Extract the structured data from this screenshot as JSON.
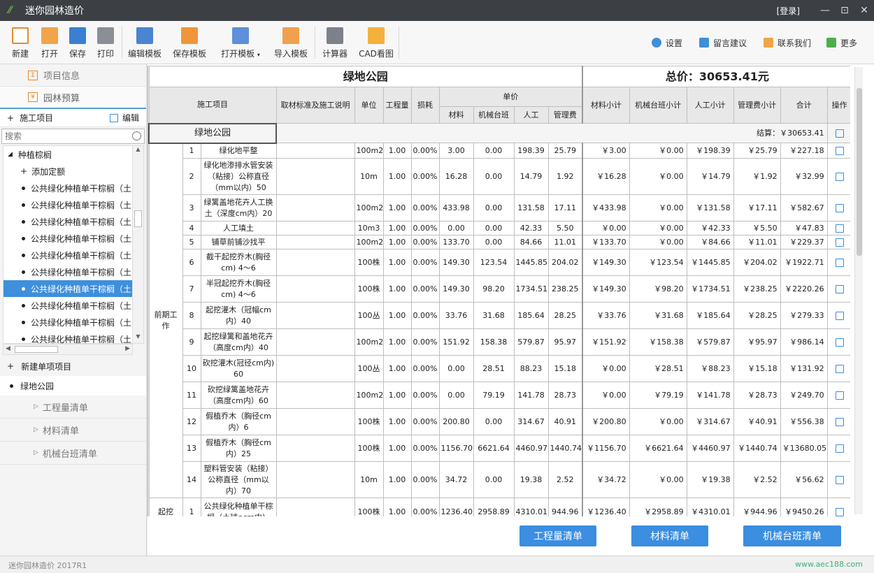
{
  "app": {
    "title": "迷你园林造价",
    "login": "[登录]",
    "version": "迷你园林造价 2017R1",
    "website": "www.aec188.com"
  },
  "window": {
    "minimize": "—",
    "restore": "⊡",
    "close": "✕"
  },
  "toolbar": {
    "new": "新建",
    "open": "打开",
    "save": "保存",
    "print": "打印",
    "edit_template": "编辑模板",
    "save_template": "保存模板",
    "open_template": "打开模板",
    "import_template": "导入模板",
    "calculator": "计算器",
    "cad": "CAD看图",
    "settings": "设置",
    "feedback": "留言建议",
    "contact": "联系我们",
    "more": "更多"
  },
  "sidebar": {
    "tab_project_info": "项目信息",
    "tab_budget": "园林预算",
    "construction_items": "施工项目",
    "edit": "编辑",
    "search_placeholder": "搜索",
    "tree": {
      "group": "种植棕榈",
      "add_quota": "添加定额",
      "items": [
        "公共绿化种植单干棕榈（土",
        "公共绿化种植单干棕榈（土",
        "公共绿化种植单干棕榈（土",
        "公共绿化种植单干棕榈（土",
        "公共绿化种植单干棕榈（土",
        "公共绿化种植单干棕榈（土",
        "公共绿化种植单干棕榈（土",
        "公共绿化种植单干棕榈（土",
        "公共绿化种植单干棕榈（土",
        "公共绿化种植单干棕榈（土"
      ],
      "selected_index": 6
    },
    "new_item": "新建单项项目",
    "project": "绿地公园",
    "sections": [
      "工程量清单",
      "材料清单",
      "机械台班清单"
    ]
  },
  "sheet": {
    "title": "绿地公园",
    "total": "总价：30653.41元",
    "headers": {
      "item": "施工项目",
      "std": "取材标准及施工说明",
      "unit": "单位",
      "qty": "工程量",
      "loss": "损耗",
      "unit_price": "单价",
      "mat": "材料",
      "mach": "机械台班",
      "labor": "人工",
      "mgmt": "管理费",
      "mat_sub": "材料小计",
      "mach_sub": "机械台班小计",
      "labor_sub": "人工小计",
      "mgmt_sub": "管理费小计",
      "sum": "合计",
      "op": "操作"
    },
    "group_name": "绿地公园",
    "settlement": "结算：￥30653.41",
    "category_1": "前期工作",
    "category_2": "起挖",
    "rows": [
      [
        "1",
        "绿化地平整",
        "100m2",
        "1.00",
        "0.00%",
        "3.00",
        "0.00",
        "198.39",
        "25.79",
        "￥3.00",
        "￥0.00",
        "￥198.39",
        "￥25.79",
        "￥227.18"
      ],
      [
        "2",
        "绿化地渗排水管安装（粘接）公称直径（mm以内）50",
        "10m",
        "1.00",
        "0.00%",
        "16.28",
        "0.00",
        "14.79",
        "1.92",
        "￥16.28",
        "￥0.00",
        "￥14.79",
        "￥1.92",
        "￥32.99"
      ],
      [
        "3",
        "绿篱盖地花卉人工换土（深度cm内）20",
        "100m2",
        "1.00",
        "0.00%",
        "433.98",
        "0.00",
        "131.58",
        "17.11",
        "￥433.98",
        "￥0.00",
        "￥131.58",
        "￥17.11",
        "￥582.67"
      ],
      [
        "4",
        "人工填土",
        "10m3",
        "1.00",
        "0.00%",
        "0.00",
        "0.00",
        "42.33",
        "5.50",
        "￥0.00",
        "￥0.00",
        "￥42.33",
        "￥5.50",
        "￥47.83"
      ],
      [
        "5",
        "铺草前铺沙找平",
        "100m2",
        "1.00",
        "0.00%",
        "133.70",
        "0.00",
        "84.66",
        "11.01",
        "￥133.70",
        "￥0.00",
        "￥84.66",
        "￥11.01",
        "￥229.37"
      ],
      [
        "6",
        "截干起挖乔木(胸径cm) 4～6",
        "100株",
        "1.00",
        "0.00%",
        "149.30",
        "123.54",
        "1445.85",
        "204.02",
        "￥149.30",
        "￥123.54",
        "￥1445.85",
        "￥204.02",
        "￥1922.71"
      ],
      [
        "7",
        "半冠起挖乔木(胸径cm) 4～6",
        "100株",
        "1.00",
        "0.00%",
        "149.30",
        "98.20",
        "1734.51",
        "238.25",
        "￥149.30",
        "￥98.20",
        "￥1734.51",
        "￥238.25",
        "￥2220.26"
      ],
      [
        "8",
        "起挖灌木（冠幅cm内）40",
        "100丛",
        "1.00",
        "0.00%",
        "33.76",
        "31.68",
        "185.64",
        "28.25",
        "￥33.76",
        "￥31.68",
        "￥185.64",
        "￥28.25",
        "￥279.33"
      ],
      [
        "9",
        "起挖绿篱和盖地花卉（高度cm内）40",
        "100m2",
        "1.00",
        "0.00%",
        "151.92",
        "158.38",
        "579.87",
        "95.97",
        "￥151.92",
        "￥158.38",
        "￥579.87",
        "￥95.97",
        "￥986.14"
      ],
      [
        "10",
        "砍挖灌木(冠径cm内) 60",
        "100丛",
        "1.00",
        "0.00%",
        "0.00",
        "28.51",
        "88.23",
        "15.18",
        "￥0.00",
        "￥28.51",
        "￥88.23",
        "￥15.18",
        "￥131.92"
      ],
      [
        "11",
        "砍挖绿篱盖地花卉（高度cm内）60",
        "100m2",
        "1.00",
        "0.00%",
        "0.00",
        "79.19",
        "141.78",
        "28.73",
        "￥0.00",
        "￥79.19",
        "￥141.78",
        "￥28.73",
        "￥249.70"
      ],
      [
        "12",
        "假植乔木（胸径cm内）6",
        "100株",
        "1.00",
        "0.00%",
        "200.80",
        "0.00",
        "314.67",
        "40.91",
        "￥200.80",
        "￥0.00",
        "￥314.67",
        "￥40.91",
        "￥556.38"
      ],
      [
        "13",
        "假植乔木（胸径cm内）25",
        "100株",
        "1.00",
        "0.00%",
        "1156.70",
        "6621.64",
        "4460.97",
        "1440.74",
        "￥1156.70",
        "￥6621.64",
        "￥4460.97",
        "￥1440.74",
        "￥13680.05"
      ],
      [
        "14",
        "塑料管安装（粘接）公称直径（mm以内）70",
        "10m",
        "1.00",
        "0.00%",
        "34.72",
        "0.00",
        "19.38",
        "2.52",
        "￥34.72",
        "￥0.00",
        "￥19.38",
        "￥2.52",
        "￥56.62"
      ],
      [
        "1",
        "公共绿化种植单干棕榈（土球φcm内）",
        "100株",
        "1.00",
        "0.00%",
        "1236.40",
        "2958.89",
        "4310.01",
        "944.96",
        "￥1236.40",
        "￥2958.89",
        "￥4310.01",
        "￥944.96",
        "￥9450.26"
      ]
    ]
  },
  "buttons": {
    "quantity": "工程量清单",
    "material": "材料清单",
    "machinery": "机械台班清单"
  }
}
